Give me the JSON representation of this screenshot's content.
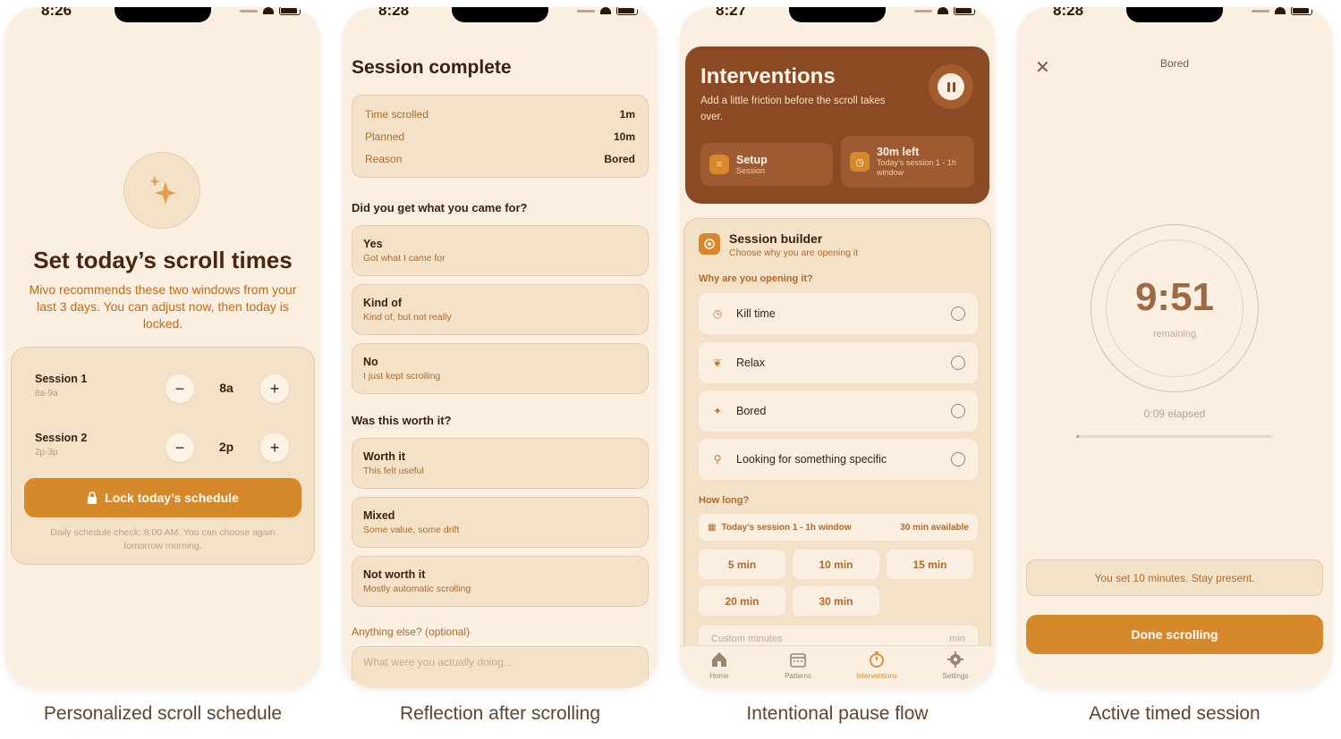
{
  "screens": [
    {
      "status_time": "8:26",
      "title": "Set today’s scroll times",
      "subtitle": "Mivo recommends these two windows from your last 3 days. You can adjust now, then today is locked.",
      "sessions": [
        {
          "name": "Session 1",
          "range": "8a-9a",
          "value": "8a"
        },
        {
          "name": "Session 2",
          "range": "2p-3p",
          "value": "2p"
        }
      ],
      "minus": "−",
      "plus": "+",
      "lock_button": "Lock today’s schedule",
      "note": "Daily schedule check: 8:00 AM. You can choose again tomorrow morning.",
      "icon": "sparkle-icon",
      "caption": "Personalized scroll schedule"
    },
    {
      "status_time": "8:28",
      "title": "Session complete",
      "summary": [
        {
          "label": "Time scrolled",
          "value": "1m"
        },
        {
          "label": "Planned",
          "value": "10m"
        },
        {
          "label": "Reason",
          "value": "Bored"
        }
      ],
      "q1": "Did you get what you came for?",
      "q1_options": [
        {
          "title": "Yes",
          "sub": "Got what I came for"
        },
        {
          "title": "Kind of",
          "sub": "Kind of, but not really"
        },
        {
          "title": "No",
          "sub": "I just kept scrolling"
        }
      ],
      "q2": "Was this worth it?",
      "q2_options": [
        {
          "title": "Worth it",
          "sub": "This felt useful"
        },
        {
          "title": "Mixed",
          "sub": "Some value, some drift"
        },
        {
          "title": "Not worth it",
          "sub": "Mostly automatic scrolling"
        }
      ],
      "anything_label": "Anything else? (optional)",
      "anything_placeholder": "What were you actually doing...",
      "caption": "Reflection after scrolling"
    },
    {
      "status_time": "8:27",
      "hero_title": "Interventions",
      "hero_sub": "Add a little friction before the scroll takes over.",
      "setup": {
        "title": "Setup",
        "sub": "Session"
      },
      "left": {
        "title": "30m left",
        "sub": "Today’s session 1 - 1h window"
      },
      "builder_title": "Session builder",
      "builder_sub": "Choose why you are opening it",
      "why_label": "Why are you opening it?",
      "reasons": [
        {
          "label": "Kill time",
          "icon": "clock-icon"
        },
        {
          "label": "Relax",
          "icon": "leaf-icon"
        },
        {
          "label": "Bored",
          "icon": "sparkle-icon"
        },
        {
          "label": "Looking for something specific",
          "icon": "search-icon"
        }
      ],
      "how_long_label": "How long?",
      "window_label": "Today’s session 1 - 1h window",
      "window_available": "30 min available",
      "durations": [
        "5 min",
        "10 min",
        "15 min",
        "20 min",
        "30 min"
      ],
      "custom_placeholder": "Custom minutes",
      "custom_unit": "min",
      "tabs": [
        {
          "label": "Home",
          "icon": "home-icon",
          "active": false
        },
        {
          "label": "Patterns",
          "icon": "calendar-icon",
          "active": false
        },
        {
          "label": "Interventions",
          "icon": "timer-icon",
          "active": true
        },
        {
          "label": "Settings",
          "icon": "gear-icon",
          "active": false
        }
      ],
      "caption": "Intentional pause flow"
    },
    {
      "status_time": "8:28",
      "reason": "Bored",
      "timer": "9:51",
      "remaining_label": "remaining",
      "elapsed": "0:09 elapsed",
      "elapsed_fraction": 0.015,
      "notice": "You set 10 minutes. Stay present.",
      "done_button": "Done scrolling",
      "caption": "Active timed session"
    }
  ],
  "colors": {
    "background": "#fbefe2",
    "card": "#f3e2c8",
    "accent": "#d6892a",
    "hero": "#8b4a24",
    "text": "#3a2210"
  }
}
